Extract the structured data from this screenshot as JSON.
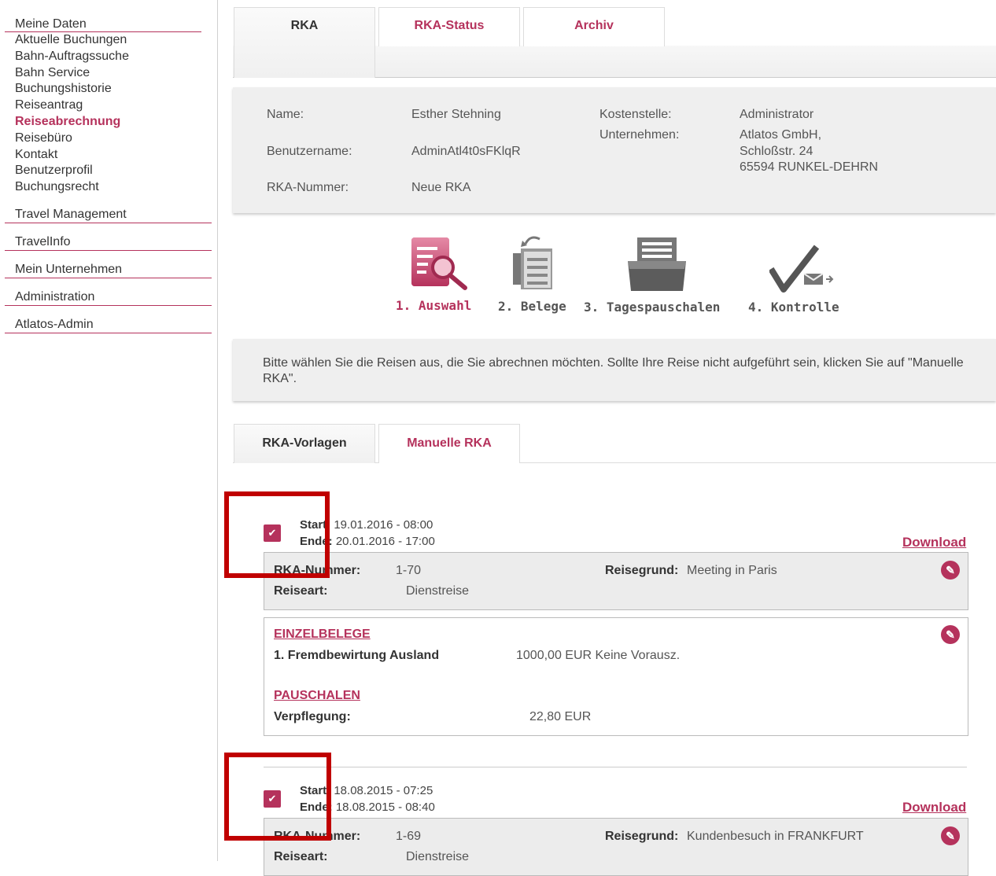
{
  "sidebar": {
    "group_title": "Meine Daten",
    "items": [
      "Aktuelle Buchungen",
      "Bahn-Auftragssuche",
      "Bahn Service",
      "Buchungshistorie",
      "Reiseantrag",
      "Reiseabrechnung",
      "Reisebüro",
      "Kontakt",
      "Benutzerprofil",
      "Buchungsrecht"
    ],
    "sections": [
      "Travel Management",
      "TravelInfo",
      "Mein Unternehmen",
      "Administration",
      "Atlatos-Admin"
    ]
  },
  "tabs": [
    "RKA",
    "RKA-Status",
    "Archiv"
  ],
  "info": {
    "name_label": "Name:",
    "name_value": "Esther Stehning",
    "user_label": "Benutzername:",
    "user_value": "AdminAtl4t0sFKlqR",
    "rka_label": "RKA-Nummer:",
    "rka_value": "Neue RKA",
    "cost_label": "Kostenstelle:",
    "cost_value": "Administrator",
    "company_label": "Unternehmen:",
    "company_line1": "Atlatos GmbH,",
    "company_line2": "Schloßstr. 24",
    "company_line3": "65594 RUNKEL-DEHRN"
  },
  "steps": [
    "1. Auswahl",
    "2. Belege",
    "3. Tagespauschalen",
    "4. Kontrolle"
  ],
  "instruction": "Bitte wählen Sie die Reisen aus, die Sie abrechnen möchten. Sollte Ihre Reise nicht aufgeführt sein, klicken Sie auf \"Manuelle RKA\".",
  "subtabs": [
    "RKA-Vorlagen",
    "Manuelle RKA"
  ],
  "labels": {
    "start": "Start:",
    "end": "Ende:",
    "download": "Download",
    "rka_nummer": "RKA-Nummer:",
    "reiseart": "Reiseart:",
    "reisegrund": "Reisegrund:",
    "einzelbelege": "EINZELBELEGE",
    "pauschalen": "PAUSCHALEN"
  },
  "trips": [
    {
      "start": "19.01.2016 - 08:00",
      "end": "20.01.2016 - 17:00",
      "rka_nr": "1-70",
      "reiseart": "Dienstreise",
      "reisegrund": "Meeting in Paris",
      "beleg_name": "1.  Fremdbewirtung Ausland",
      "beleg_amount": "1000,00 EUR Keine Vorausz.",
      "pauschale_name": "Verpflegung:",
      "pauschale_amount": "22,80 EUR"
    },
    {
      "start": "18.08.2015 - 07:25",
      "end": "18.08.2015 - 08:40",
      "rka_nr": "1-69",
      "reiseart": "Dienstreise",
      "reisegrund": "Kundenbesuch in FRANKFURT"
    }
  ],
  "colors": {
    "accent": "#b5325c",
    "highlight": "#c00000"
  }
}
